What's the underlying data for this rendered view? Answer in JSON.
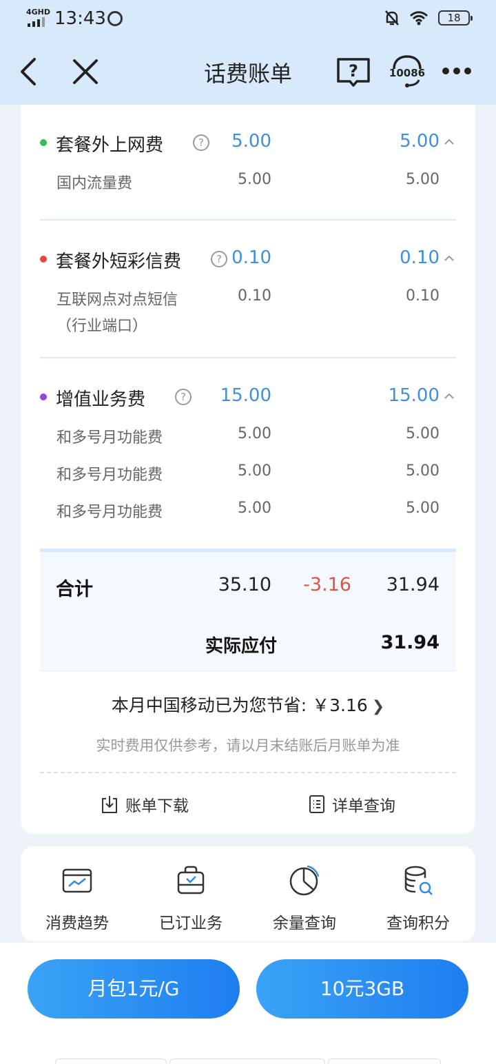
{
  "status_bar": {
    "network": "4GHD",
    "time": "13:43",
    "battery": "18"
  },
  "nav": {
    "title": "话费账单",
    "service_number": "10086",
    "help_symbol": "?"
  },
  "sections": [
    {
      "name": "套餐外上网费",
      "dot_color": "#2fbf58",
      "amount": "5.00",
      "amount_total": "5.00",
      "rows": [
        {
          "name": "国内流量费",
          "amount": "5.00",
          "total": "5.00"
        }
      ]
    },
    {
      "name": "套餐外短彩信费",
      "dot_color": "#e8453c",
      "amount": "0.10",
      "amount_total": "0.10",
      "rows": [
        {
          "name": "互联网点对点短信",
          "name2": "（行业端口）",
          "amount": "0.10",
          "total": "0.10"
        }
      ]
    },
    {
      "name": "增值业务费",
      "dot_color": "#9b3fd9",
      "amount": "15.00",
      "amount_total": "15.00",
      "rows": [
        {
          "name": "和多号月功能费",
          "amount": "5.00",
          "total": "5.00"
        },
        {
          "name": "和多号月功能费",
          "amount": "5.00",
          "total": "5.00"
        },
        {
          "name": "和多号月功能费",
          "amount": "5.00",
          "total": "5.00"
        }
      ]
    }
  ],
  "totals": {
    "label": "合计",
    "amount": "35.10",
    "discount": "-3.16",
    "total": "31.94",
    "pay_label": "实际应付",
    "pay_value": "31.94"
  },
  "saving_text": "本月中国移动已为您节省: ￥3.16",
  "note": "实时费用仅供参考，请以月末结账后月账单为准",
  "actions": {
    "download": "账单下载",
    "detail": "详单查询"
  },
  "shortcuts": [
    {
      "label": "消费趋势",
      "icon": "trend-chart-icon"
    },
    {
      "label": "已订业务",
      "icon": "subscribed-bag-icon"
    },
    {
      "label": "余量查询",
      "icon": "pie-chart-icon"
    },
    {
      "label": "查询积分",
      "icon": "coins-search-icon"
    }
  ],
  "buttons": {
    "left": "月包1元/G",
    "right": "10元3GB"
  },
  "colors": {
    "accent_blue": "#3b8fe5",
    "discount_red": "#e2533f",
    "header_bg": "#d7e9fb"
  }
}
